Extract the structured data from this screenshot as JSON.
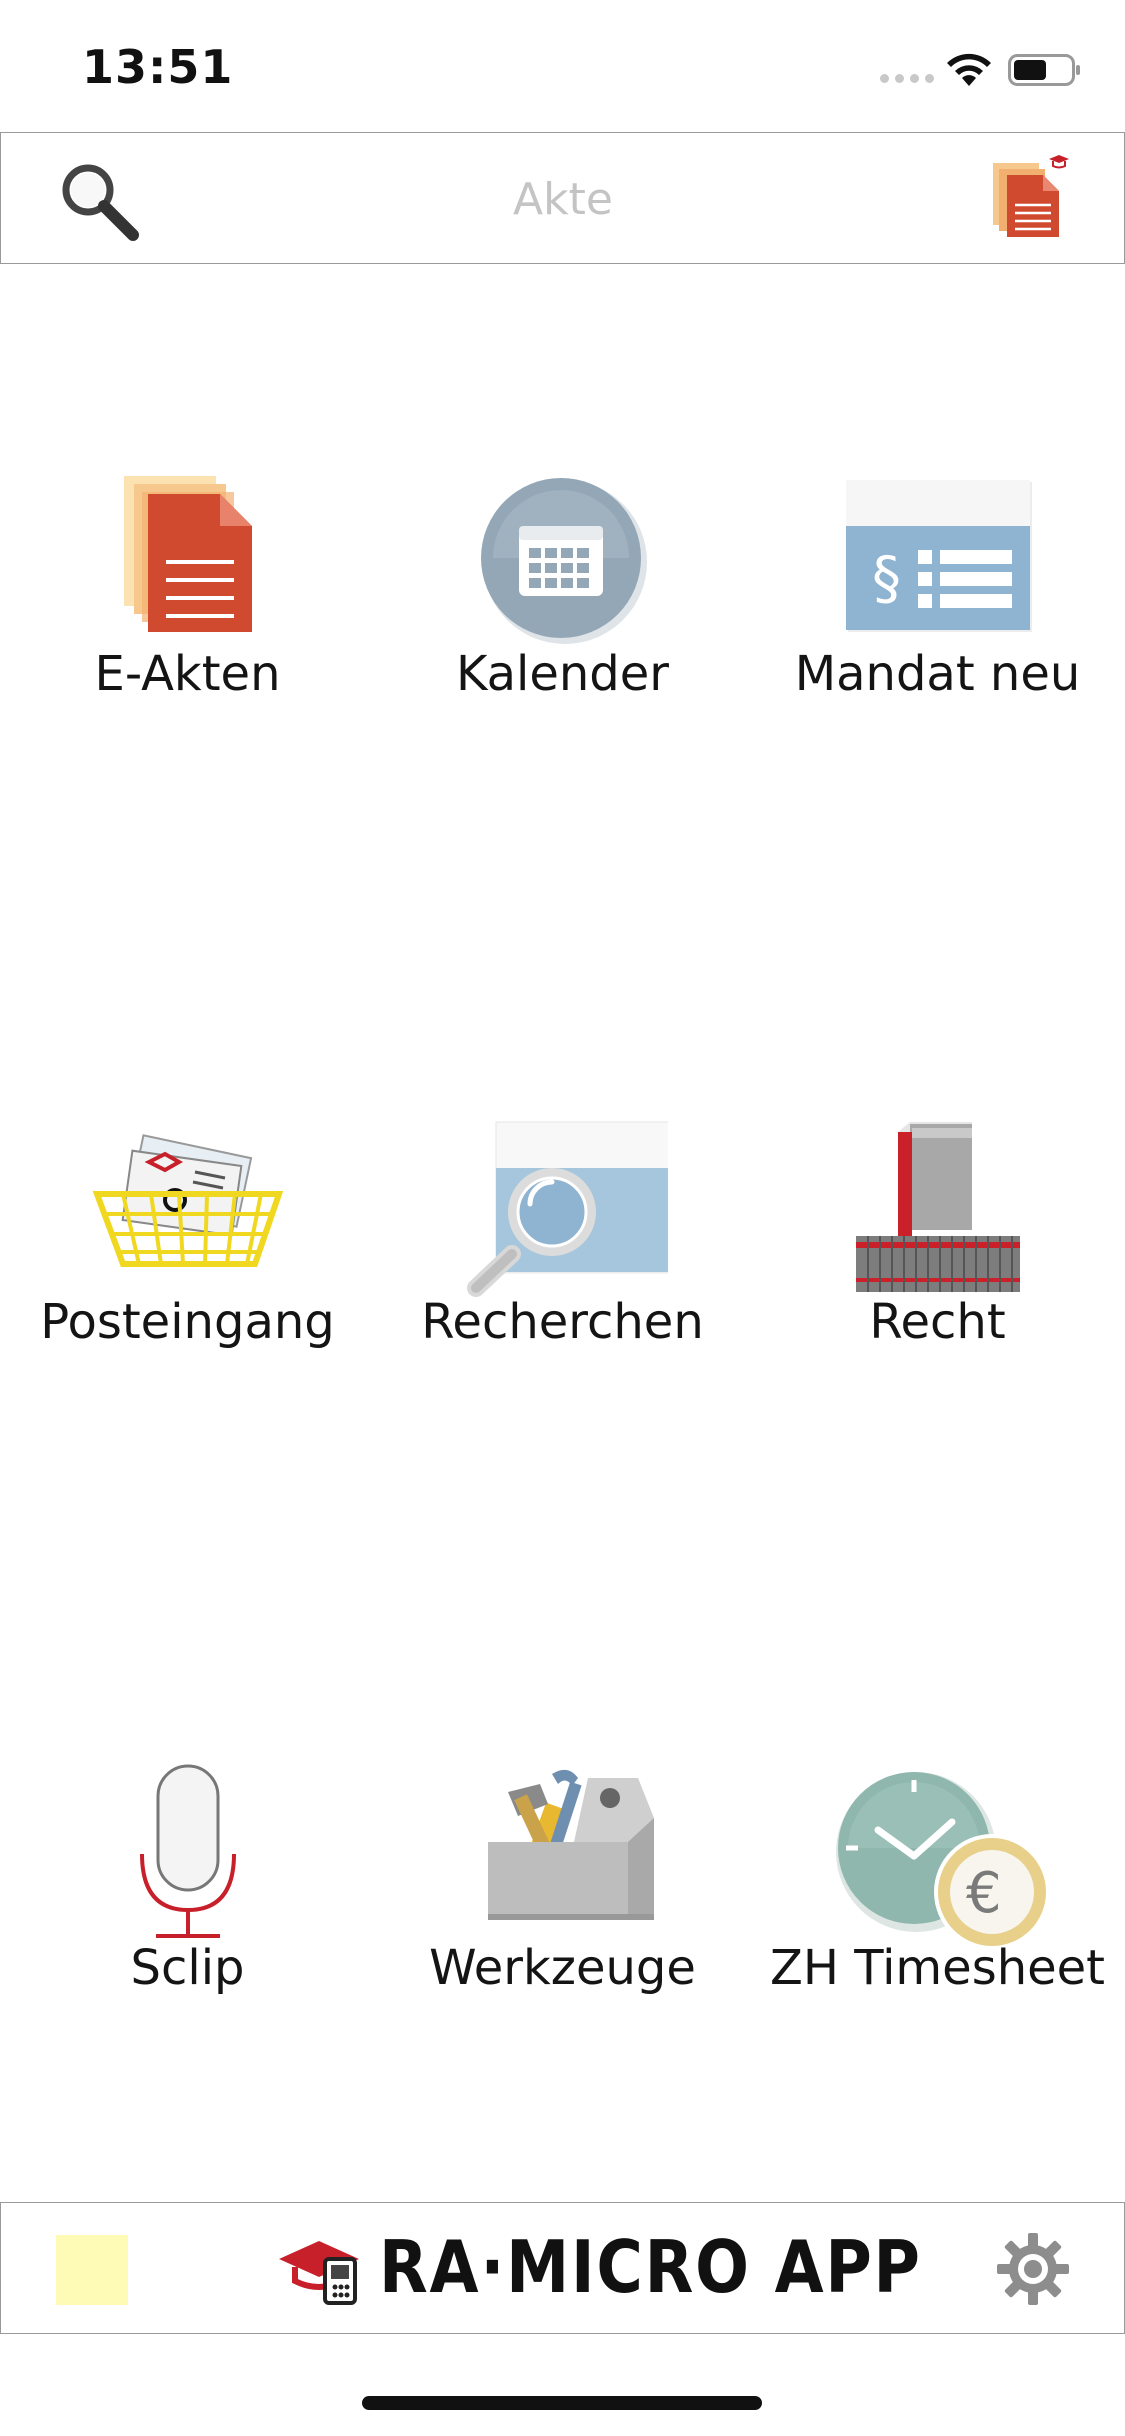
{
  "status_bar": {
    "time": "13:51"
  },
  "search": {
    "placeholder": "Akte",
    "value": ""
  },
  "grid": {
    "items": [
      {
        "label": "E-Akten",
        "icon": "documents-icon"
      },
      {
        "label": "Kalender",
        "icon": "calendar-icon"
      },
      {
        "label": "Mandat neu",
        "icon": "new-mandate-icon"
      },
      {
        "label": "Posteingang",
        "icon": "mail-basket-icon"
      },
      {
        "label": "Recherchen",
        "icon": "research-magnifier-icon"
      },
      {
        "label": "Recht",
        "icon": "law-books-icon"
      },
      {
        "label": "Sclip",
        "icon": "microphone-icon"
      },
      {
        "label": "Werkzeuge",
        "icon": "toolbox-icon"
      },
      {
        "label": "ZH Timesheet",
        "icon": "clock-euro-icon"
      }
    ]
  },
  "bottom_bar": {
    "brand": "RA·MICRO APP"
  },
  "colors": {
    "accent_red": "#d04a2f",
    "calendar_blue": "#93a7b7",
    "mandate_blue": "#8fb4d2",
    "clock_teal": "#8fb7ae",
    "coin_gold": "#e8d08a",
    "note_yellow": "#fefbb6"
  }
}
